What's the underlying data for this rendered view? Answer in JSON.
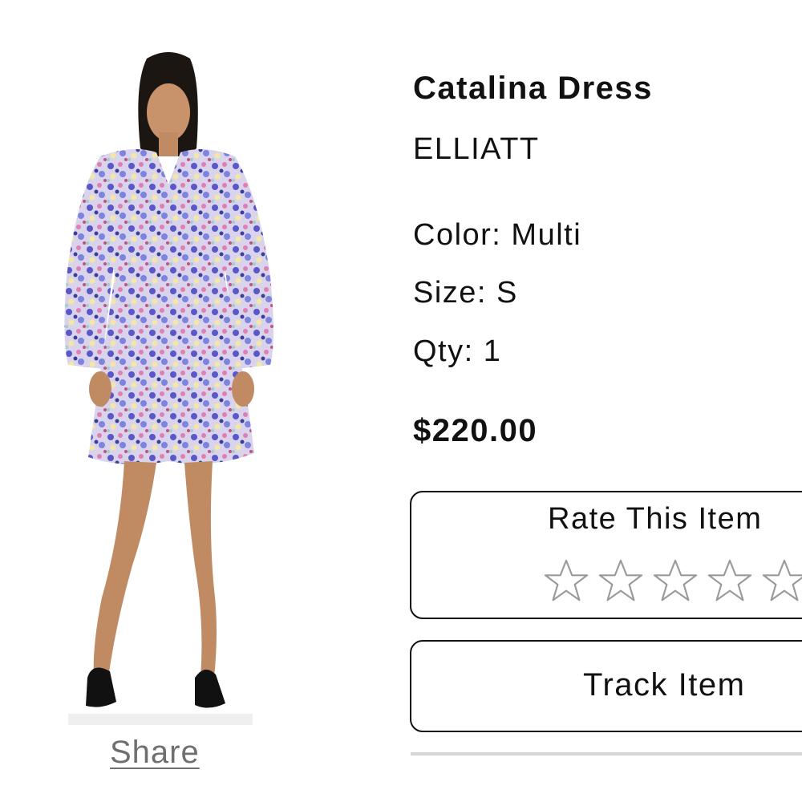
{
  "product": {
    "title": "Catalina Dress",
    "brand": "ELLIATT",
    "color": "Color: Multi",
    "size": "Size: S",
    "qty": "Qty: 1",
    "price": "$220.00",
    "image_icon": "dress-photo"
  },
  "actions": {
    "share_label": "Share",
    "rate_title": "Rate This Item",
    "rating": {
      "value": 0,
      "max": 5
    },
    "track_label": "Track Item"
  },
  "colors": {
    "text": "#111111",
    "share": "#6f6f6f",
    "divider": "#d6d6d6",
    "star_outline": "#9a9a9a"
  }
}
